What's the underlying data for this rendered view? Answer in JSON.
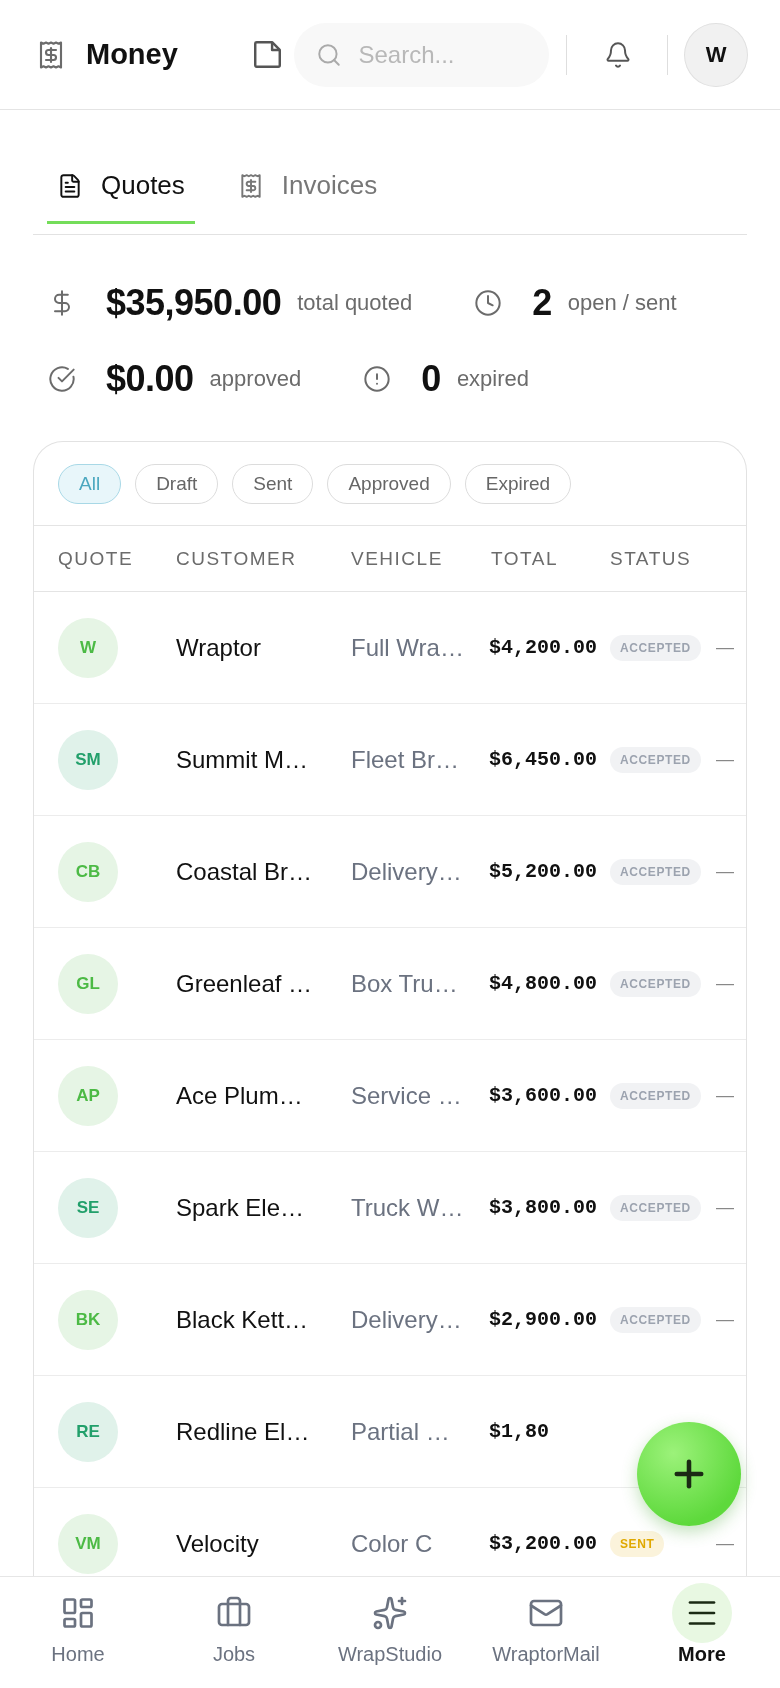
{
  "header": {
    "title": "Money",
    "search": {
      "placeholder": "Search..."
    },
    "avatar": "W"
  },
  "tabs": [
    {
      "label": "Quotes",
      "selected": true
    },
    {
      "label": "Invoices",
      "selected": false
    }
  ],
  "stats": [
    {
      "value": "$35,950.00",
      "label": "total quoted"
    },
    {
      "value": "2",
      "label": "open / sent"
    },
    {
      "value": "$0.00",
      "label": "approved"
    },
    {
      "value": "0",
      "label": "expired"
    }
  ],
  "filters": [
    {
      "label": "All",
      "selected": true
    },
    {
      "label": "Draft",
      "selected": false
    },
    {
      "label": "Sent",
      "selected": false
    },
    {
      "label": "Approved",
      "selected": false
    },
    {
      "label": "Expired",
      "selected": false
    }
  ],
  "table": {
    "columns": [
      "QUOTE",
      "CUSTOMER",
      "VEHICLE",
      "TOTAL",
      "STATUS"
    ],
    "rows": [
      {
        "initials": "W",
        "color": "#4cba45",
        "customer": "Wraptor",
        "vehicle": "Full Wra…",
        "total": "$4,200.00",
        "status": {
          "label": "ACCEPTED",
          "color": "#9ca3af"
        },
        "column_6": "—"
      },
      {
        "initials": "SM",
        "color": "#22a06b",
        "customer": "Summit M…",
        "vehicle": "Fleet Br…",
        "total": "$6,450.00",
        "status": {
          "label": "ACCEPTED",
          "color": "#9ca3af"
        },
        "column_6": "—"
      },
      {
        "initials": "CB",
        "color": "#4cba45",
        "customer": "Coastal Br…",
        "vehicle": "Delivery…",
        "total": "$5,200.00",
        "status": {
          "label": "ACCEPTED",
          "color": "#9ca3af"
        },
        "column_6": "—"
      },
      {
        "initials": "GL",
        "color": "#4cba45",
        "customer": "Greenleaf …",
        "vehicle": "Box Tru…",
        "total": "$4,800.00",
        "status": {
          "label": "ACCEPTED",
          "color": "#9ca3af"
        },
        "column_6": "—"
      },
      {
        "initials": "AP",
        "color": "#4cba45",
        "customer": "Ace Plum…",
        "vehicle": "Service …",
        "total": "$3,600.00",
        "status": {
          "label": "ACCEPTED",
          "color": "#9ca3af"
        },
        "column_6": "—"
      },
      {
        "initials": "SE",
        "color": "#22a06b",
        "customer": "Spark Ele…",
        "vehicle": "Truck W…",
        "total": "$3,800.00",
        "status": {
          "label": "ACCEPTED",
          "color": "#9ca3af"
        },
        "column_6": "—"
      },
      {
        "initials": "BK",
        "color": "#4cba45",
        "customer": "Black Kett…",
        "vehicle": "Delivery…",
        "total": "$2,900.00",
        "status": {
          "label": "ACCEPTED",
          "color": "#9ca3af"
        },
        "column_6": "—"
      },
      {
        "initials": "RE",
        "color": "#22a06b",
        "customer": "Redline El…",
        "vehicle": "Partial …",
        "total": "$1,80"
      },
      {
        "initials": "VM",
        "color": "#4cba45",
        "customer": "Velocity",
        "vehicle": "Color C",
        "total": "$3,200.00",
        "status": {
          "label": "SENT",
          "color": "#e0a800"
        },
        "column_6": "—"
      }
    ]
  },
  "nav": [
    {
      "label": "Home",
      "selected": false
    },
    {
      "label": "Jobs",
      "selected": false
    },
    {
      "label": "WrapStudio",
      "selected": false
    },
    {
      "label": "WraptorMail",
      "selected": false
    },
    {
      "label": "More",
      "selected": true
    }
  ]
}
